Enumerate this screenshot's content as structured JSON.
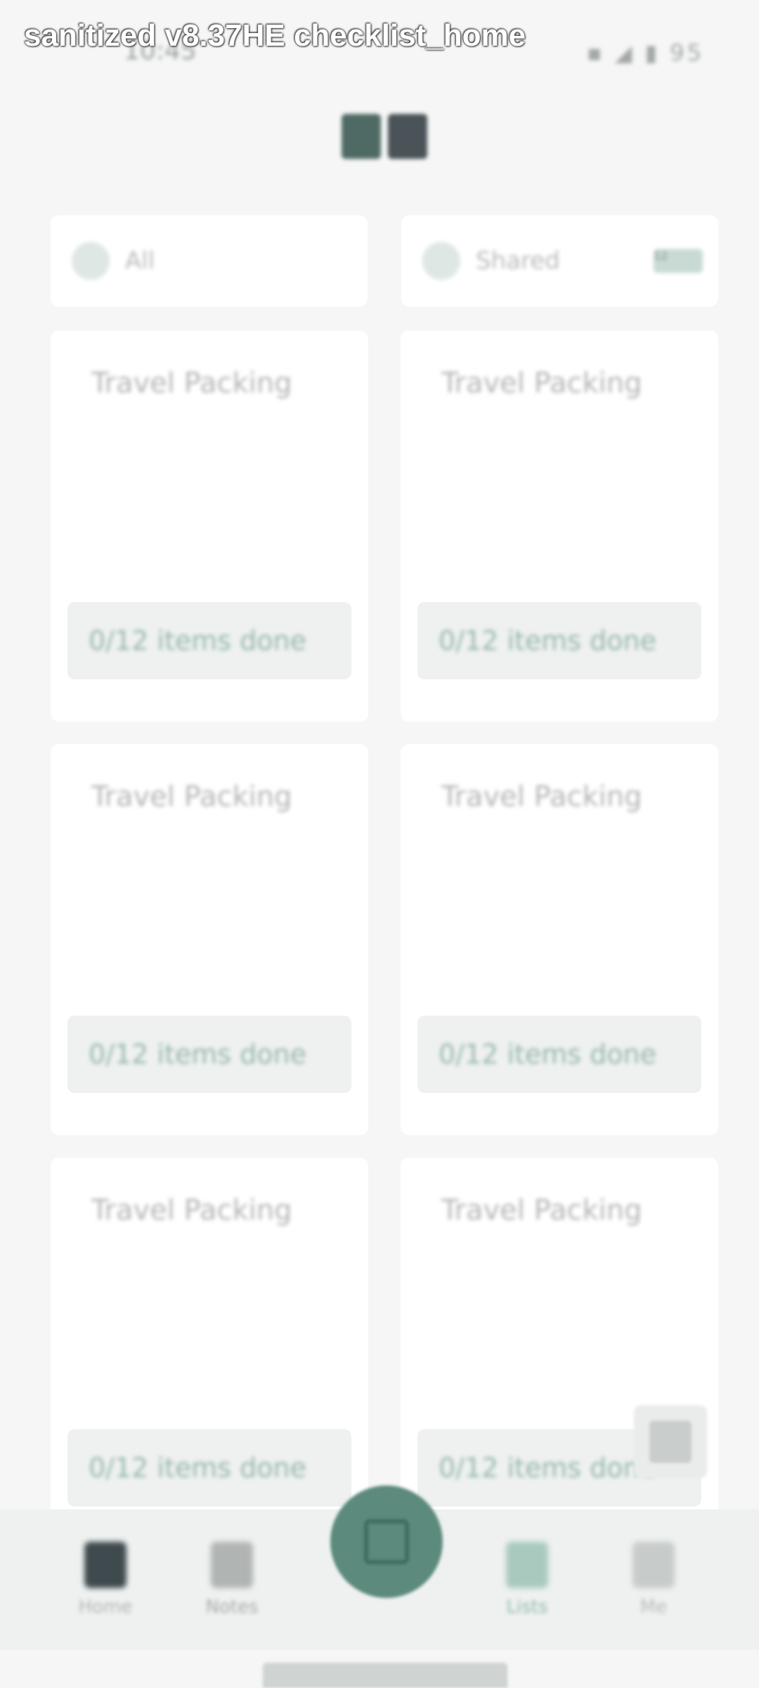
{
  "screen_label": "sanitized v8.37HE checklist_home",
  "status_bar": {
    "time": "10:45",
    "icons": "▪ ◢ ▮ 95"
  },
  "filters": [
    {
      "label": "All",
      "badge": ""
    },
    {
      "label": "Shared",
      "badge": "12"
    }
  ],
  "cards": [
    {
      "title": "Travel Packing",
      "footer": "0/12 items done"
    },
    {
      "title": "Travel Packing",
      "footer": "0/12 items done"
    },
    {
      "title": "Travel Packing",
      "footer": "0/12 items done"
    },
    {
      "title": "Travel Packing",
      "footer": "0/12 items done"
    },
    {
      "title": "Travel Packing",
      "footer": "0/12 items done"
    },
    {
      "title": "Travel Packing",
      "footer": "0/12 items done"
    }
  ],
  "bottom_nav": [
    {
      "label": "Home",
      "icon": "home-icon",
      "color": "#3f4a4e"
    },
    {
      "label": "Notes",
      "icon": "note-icon",
      "color": "#b0b4b2"
    },
    {
      "label": "Lists",
      "icon": "checklist-icon",
      "color": "#a9c9be"
    },
    {
      "label": "Me",
      "icon": "profile-icon",
      "color": "#c7cbc9"
    }
  ],
  "accent_color": "#5c8a7c"
}
